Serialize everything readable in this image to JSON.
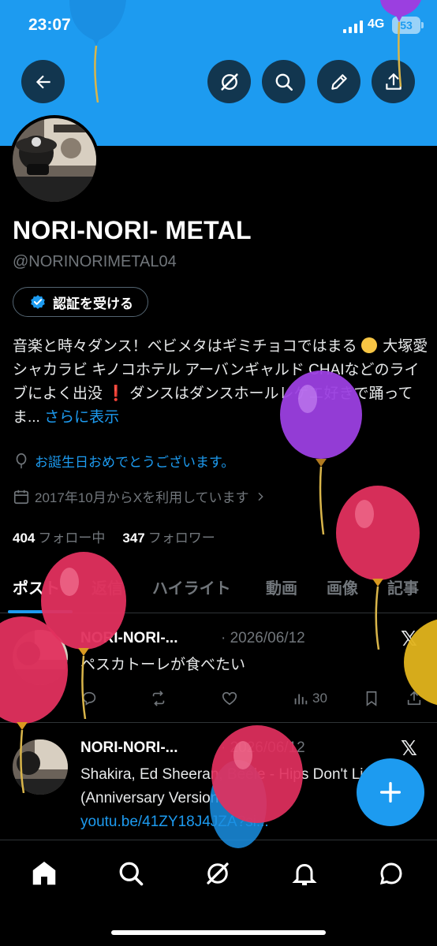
{
  "status_bar": {
    "time": "23:07",
    "network": "4G",
    "battery": "53"
  },
  "header": {
    "back_icon": "arrow-left-icon",
    "actions": [
      "grok-icon",
      "search-icon",
      "edit-icon",
      "share-icon"
    ]
  },
  "profile": {
    "name": "NORI-NORI- METAL",
    "handle": "@NORINORIMETAL04",
    "verify_label": "認証を受ける",
    "bio_part1": "音楽と時々ダンス！ベビメタはギミチョコではまる",
    "bio_part2": "大塚愛 シャカラビ キノコホテル アーバンギャルド CHAIなどのライブによく出没",
    "bio_part3": "ダンスはダンスホールレゲエ好きで踊ってま...",
    "bio_more": "さらに表示",
    "birthday": "お誕生日おめでとうございます。",
    "joined": "2017年10月からXを利用しています",
    "following_count": "404",
    "following_label": "フォロー中",
    "followers_count": "347",
    "followers_label": "フォロワー"
  },
  "tabs": [
    "ポスト",
    "返信",
    "ハイライト",
    "動画",
    "画像",
    "記事"
  ],
  "posts": [
    {
      "author": "NORI-NORI-...",
      "date": "· 2026/06/12",
      "text": "ペスカトーレが食べたい",
      "views": "30"
    },
    {
      "author": "NORI-NORI-...",
      "date": "· 2026/06/12",
      "text": "Shakira, Ed Sheeran, Beéle - Hips Don't Lie (Anniversary Version",
      "link": "youtu.be/41ZY18J4JZA?si..."
    }
  ],
  "nav": [
    "home-icon",
    "search-icon",
    "grok-icon",
    "notifications-icon",
    "messages-icon"
  ],
  "colors": {
    "accent": "#1d9bf0",
    "background": "#000000",
    "muted": "#71767b"
  }
}
